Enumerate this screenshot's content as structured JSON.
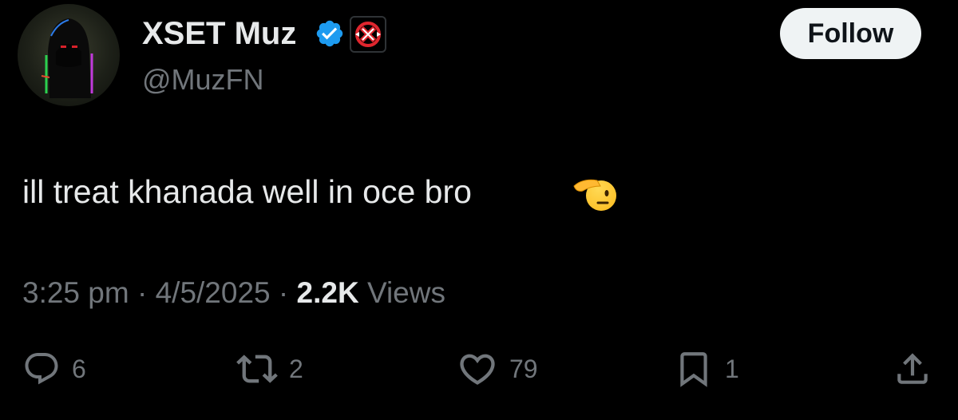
{
  "author": {
    "display_name": "XSET Muz",
    "handle": "@MuzFN",
    "verified": true,
    "affiliate": "XSET",
    "avatar": "hooded-figure-avatar"
  },
  "follow_button": {
    "label": "Follow"
  },
  "tweet": {
    "text": "ill treat khanada well in oce bro",
    "emoji": "saluting-face-emoji"
  },
  "meta": {
    "time": "3:25 pm",
    "separator": "·",
    "date": "4/5/2025",
    "views_count": "2.2K",
    "views_label": "Views"
  },
  "actions": {
    "reply": {
      "icon": "reply-icon",
      "count": "6"
    },
    "retweet": {
      "icon": "retweet-icon",
      "count": "2"
    },
    "like": {
      "icon": "heart-icon",
      "count": "79"
    },
    "bookmark": {
      "icon": "bookmark-icon",
      "count": "1"
    },
    "share": {
      "icon": "share-icon"
    }
  },
  "colors": {
    "background": "#000000",
    "primary_text": "#e7e9ea",
    "secondary_text": "#71767b",
    "verified_blue": "#1d9bf0",
    "affiliate_red": "#e0262e",
    "follow_bg": "#eff3f4"
  }
}
